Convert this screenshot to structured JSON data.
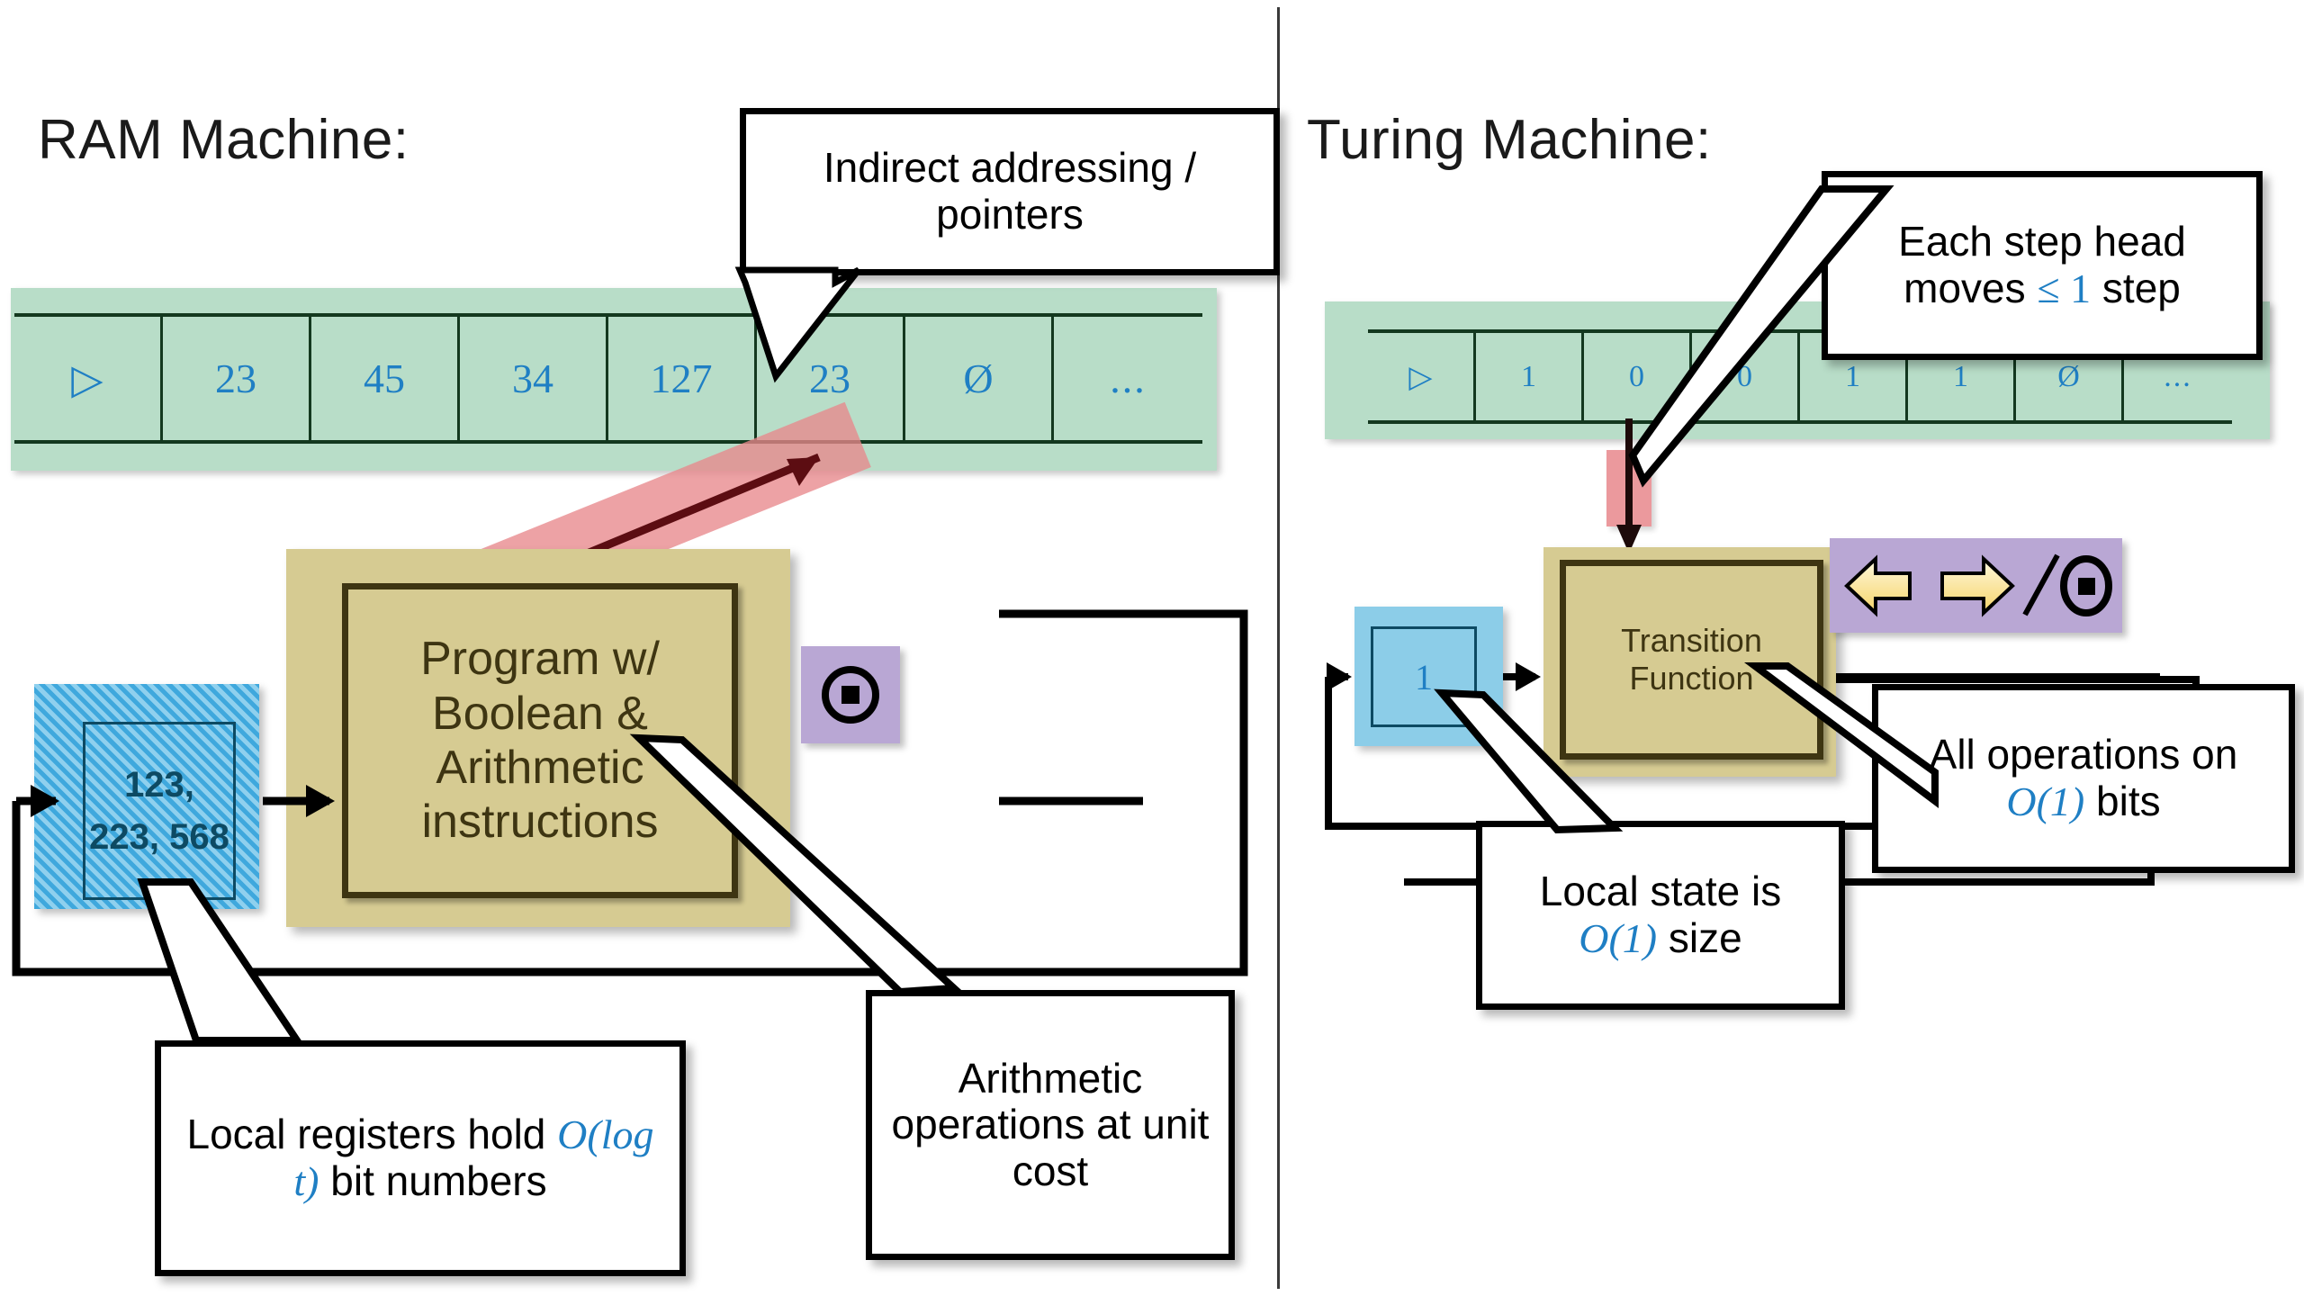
{
  "ram": {
    "title": "RAM Machine:",
    "tape_cells": [
      "▷",
      "23",
      "45",
      "34",
      "127",
      "23",
      "Ø",
      "..."
    ],
    "program_box": "Program w/ Boolean & Arithmetic instructions",
    "register_box": "123, 223, 568",
    "halt_badge_icon": "halt-stop-icon",
    "callouts": {
      "pointers": "Indirect addressing / pointers",
      "registers_pre": "Local registers hold ",
      "registers_hl": "O(log t)",
      "registers_post": " bit numbers",
      "arith": "Arithmetic operations at unit cost"
    }
  },
  "tm": {
    "title": "Turing Machine:",
    "tape_cells": [
      "▷",
      "1",
      "0",
      "0",
      "1",
      "1",
      "Ø",
      "..."
    ],
    "transition_box": "Transition Function",
    "state_box": "1",
    "move_badge_icons": [
      "arrow-left-icon",
      "arrow-right-icon",
      "slash-icon",
      "halt-stop-icon"
    ],
    "head_marker": "tape-head-marker",
    "callouts": {
      "step_pre": "Each step head moves ",
      "step_hl": "≤ 1",
      "step_post": " step",
      "state_pre": "Local state is ",
      "state_hl": "O(1)",
      "state_post": " size",
      "ops_pre": "All operations on ",
      "ops_hl": "O(1)",
      "ops_post": " bits"
    }
  },
  "colors": {
    "tape_green": "#b8ddc8",
    "cell_text_blue": "#1f7fc4",
    "gold": "#d6cb92",
    "gold_border": "#3e3512",
    "register_blue": "#3fa8dd",
    "state_blue": "#8ccde8",
    "purple": "#b9a7d4",
    "head_red": "#e8888c",
    "pointer_red": "#e8888c",
    "divider": "#3a3a3a"
  }
}
